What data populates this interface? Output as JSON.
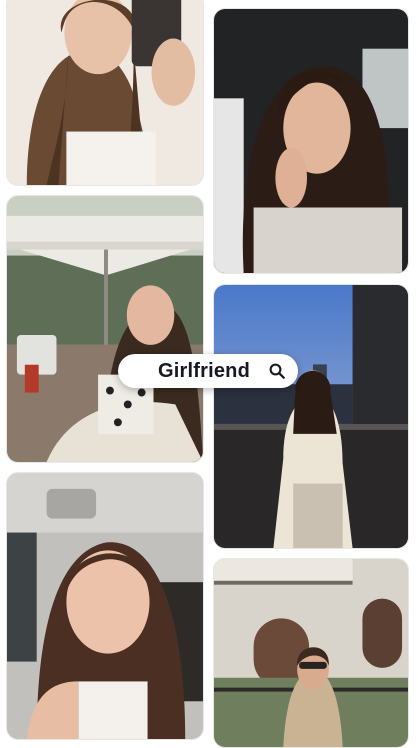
{
  "search": {
    "query": "Girlfriend",
    "icon": "search-icon"
  },
  "feed": {
    "items": [
      {
        "name": "photo-mirror-selfie"
      },
      {
        "name": "photo-hand-on-chin-selfie"
      },
      {
        "name": "photo-rooftop-umbrella"
      },
      {
        "name": "photo-balcony-city-dusk"
      },
      {
        "name": "photo-car-wink-selfie"
      },
      {
        "name": "photo-courtyard-sunglasses"
      }
    ]
  },
  "colors": {
    "text": "#161823",
    "pill_background": "#ffffff",
    "icon": "#161823"
  }
}
